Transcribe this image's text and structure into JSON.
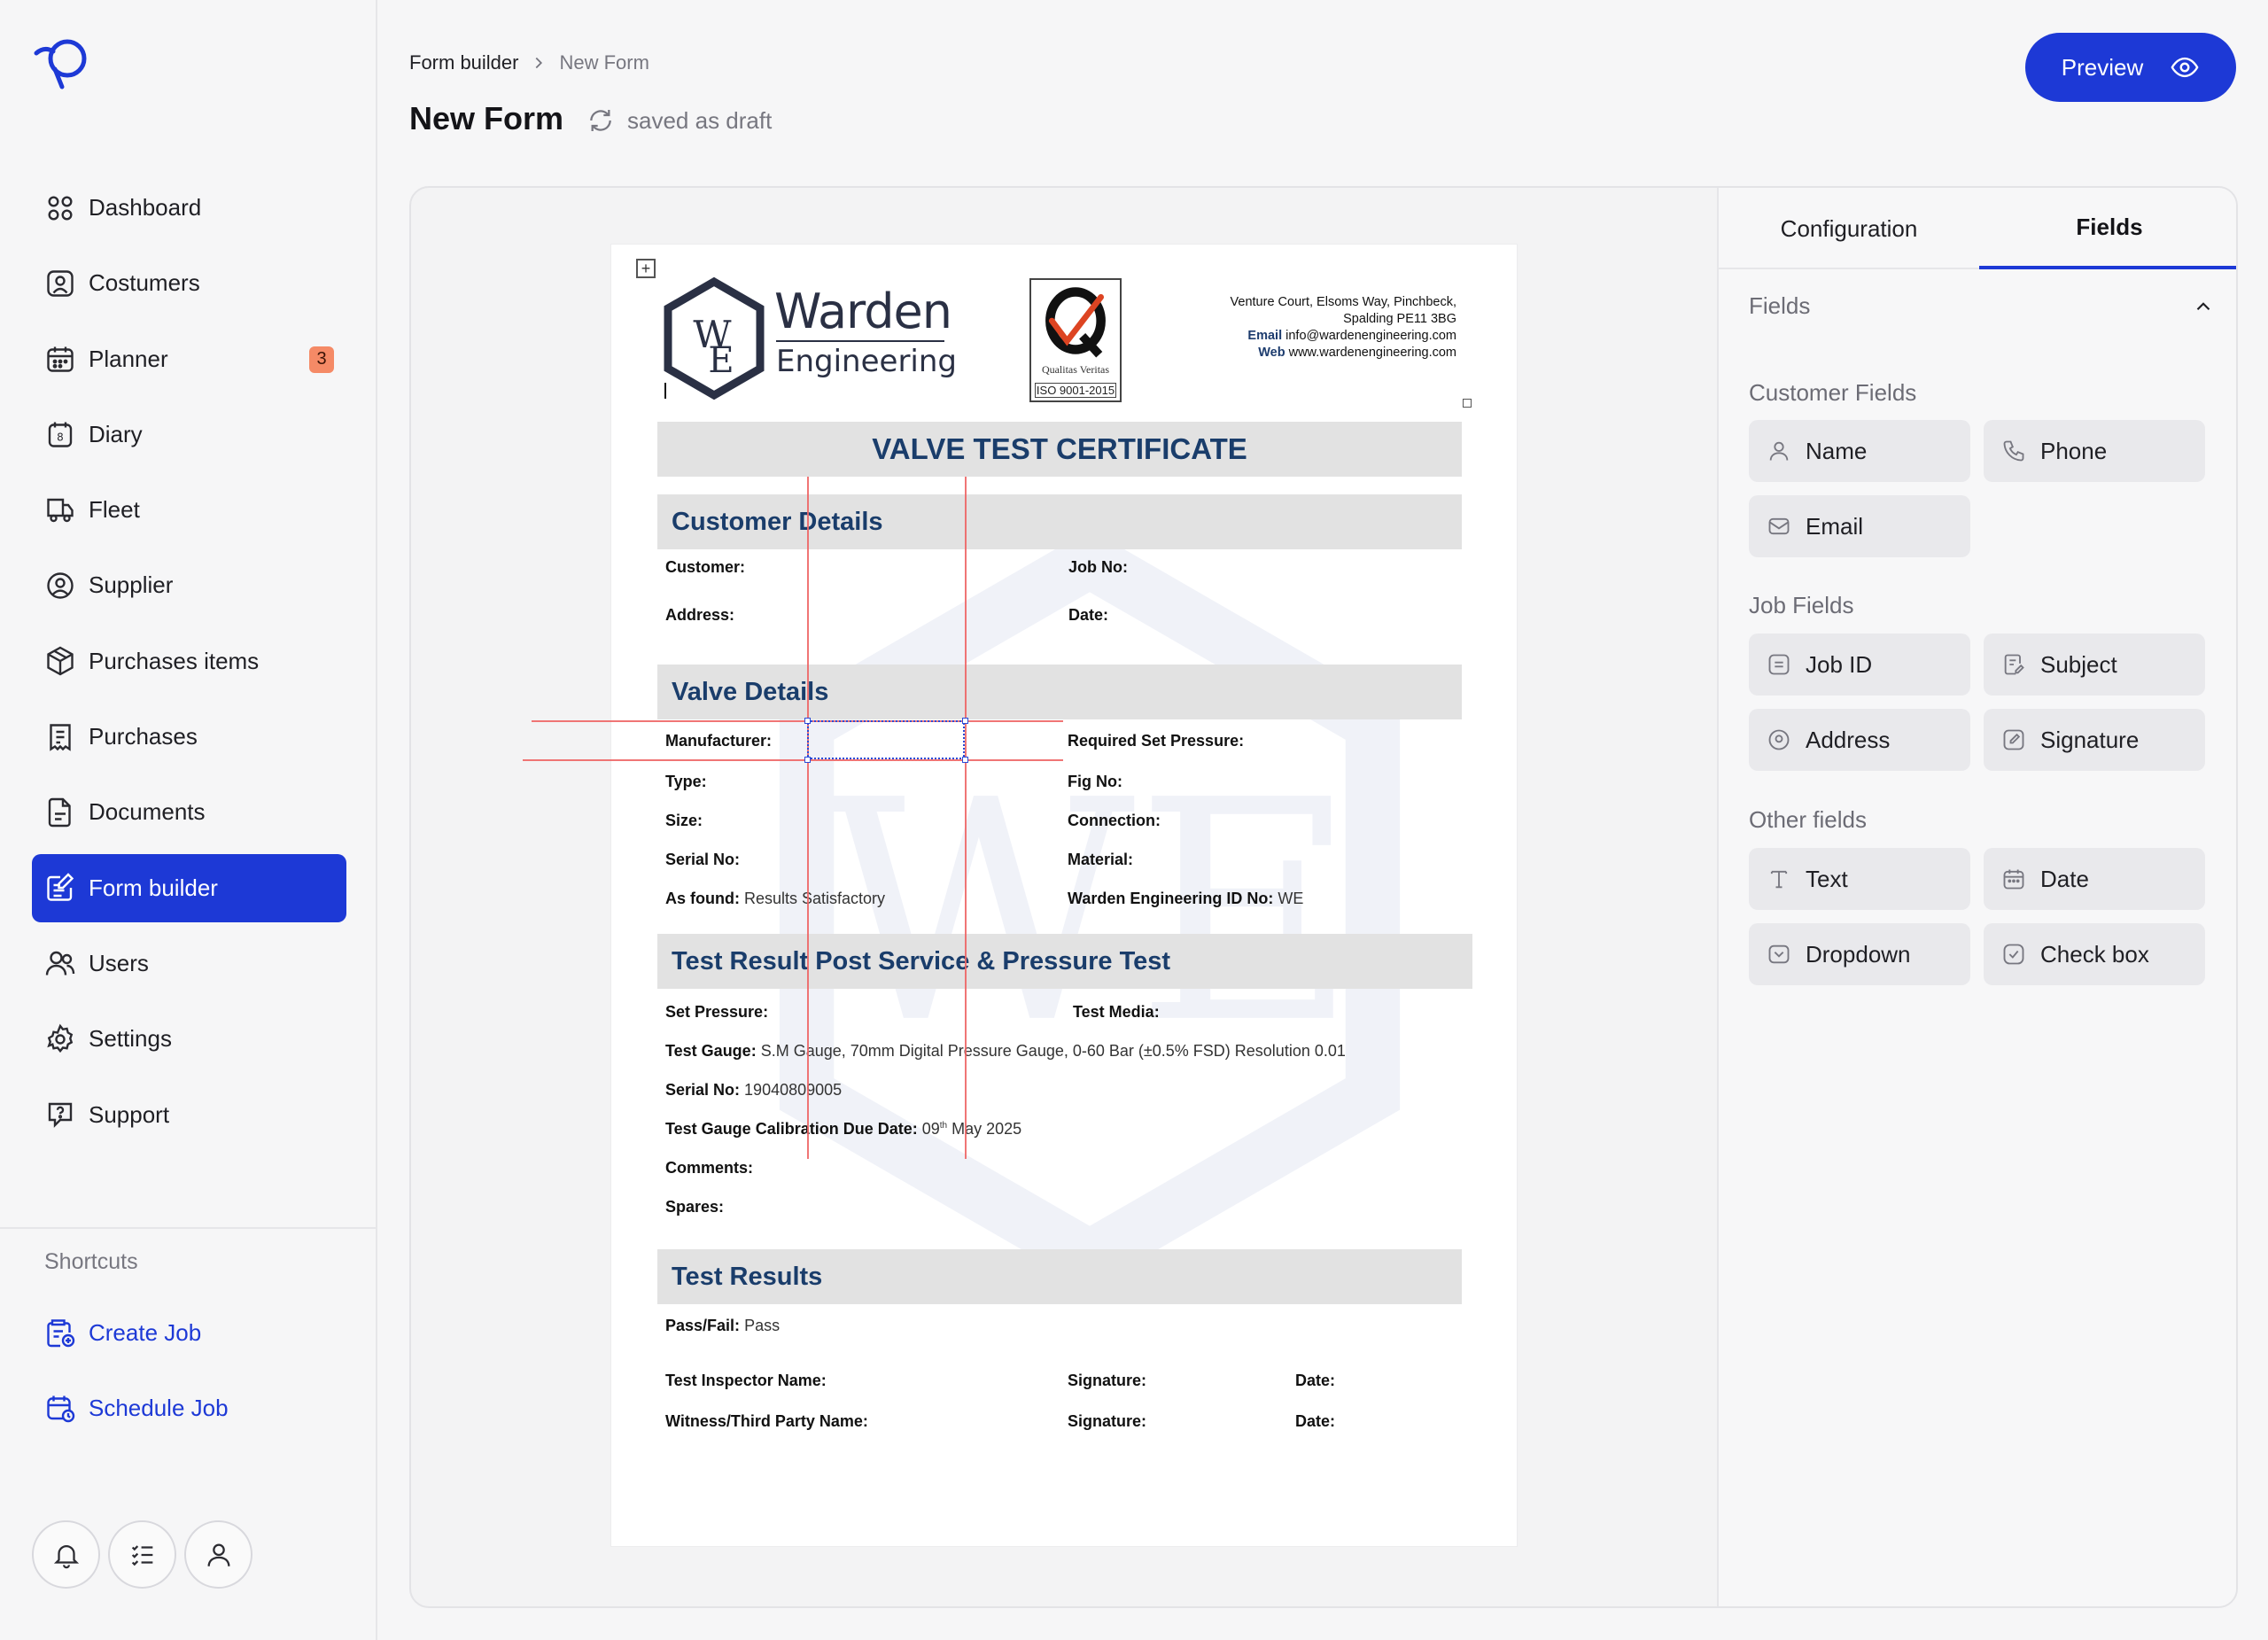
{
  "sidebar": {
    "items": [
      {
        "label": "Dashboard",
        "icon": "dashboard-icon"
      },
      {
        "label": "Costumers",
        "icon": "customers-icon"
      },
      {
        "label": "Planner",
        "icon": "calendar-icon",
        "badge": "3"
      },
      {
        "label": "Diary",
        "icon": "diary-icon"
      },
      {
        "label": "Fleet",
        "icon": "truck-icon"
      },
      {
        "label": "Supplier",
        "icon": "supplier-icon"
      },
      {
        "label": "Purchases items",
        "icon": "box-icon"
      },
      {
        "label": "Purchases",
        "icon": "receipt-icon"
      },
      {
        "label": "Documents",
        "icon": "document-icon"
      },
      {
        "label": "Form builder",
        "icon": "form-builder-icon",
        "active": true
      },
      {
        "label": "Users",
        "icon": "users-icon"
      },
      {
        "label": "Settings",
        "icon": "gear-icon"
      },
      {
        "label": "Support",
        "icon": "support-icon"
      }
    ],
    "shortcuts_title": "Shortcuts",
    "shortcuts": [
      {
        "label": "Create Job",
        "icon": "create-job-icon"
      },
      {
        "label": "Schedule Job",
        "icon": "schedule-job-icon"
      }
    ],
    "accent_color": "#1d39d6",
    "badge_color": "#f58a66"
  },
  "header": {
    "breadcrumb": [
      "Form builder",
      "New Form"
    ],
    "title": "New Form",
    "status": "saved as draft",
    "preview_label": "Preview"
  },
  "document": {
    "company_line1": "Warden",
    "company_line2": "Engineering",
    "iso_caption": "Qualitas Veritas",
    "iso_label": "ISO 9001-2015",
    "address_line1": "Venture Court, Elsoms Way, Pinchbeck,",
    "address_line2": "Spalding PE11 3BG",
    "email_label": "Email",
    "email_value": "info@wardenengineering.com",
    "web_label": "Web",
    "web_value": "www.wardenengineering.com",
    "title": "VALVE TEST CERTIFICATE",
    "sections": {
      "customer": "Customer Details",
      "valve": "Valve Details",
      "test": "Test Result Post Service & Pressure Test",
      "results": "Test Results"
    },
    "customer_fields": {
      "customer": "Customer:",
      "job_no": "Job No:",
      "address": "Address:",
      "date": "Date:"
    },
    "valve_fields": {
      "manufacturer": "Manufacturer:",
      "required_set_pressure": "Required Set Pressure:",
      "type": "Type:",
      "fig_no": "Fig No:",
      "size": "Size:",
      "connection": "Connection:",
      "serial_no": "Serial No:",
      "material": "Material:",
      "as_found": "As found:",
      "as_found_value": "Results Satisfactory",
      "warden_id": "Warden Engineering ID No:",
      "warden_id_value": "WE"
    },
    "test_fields": {
      "set_pressure": "Set Pressure:",
      "test_media": "Test Media:",
      "test_gauge": "Test Gauge:",
      "test_gauge_value": "S.M Gauge, 70mm Digital Pressure Gauge, 0-60 Bar (±0.5% FSD) Resolution 0.01",
      "serial_no": "Serial No:",
      "serial_no_value": "19040809005",
      "calibration": "Test Gauge Calibration Due Date:",
      "calibration_day": "09",
      "calibration_suffix": "th",
      "calibration_rest": "May 2025",
      "comments": "Comments:",
      "spares": "Spares:"
    },
    "results_fields": {
      "pass_fail": "Pass/Fail:",
      "pass_fail_value": "Pass",
      "inspector": "Test Inspector Name:",
      "signature": "Signature:",
      "date": "Date:",
      "witness": "Witness/Third Party Name:"
    }
  },
  "panel": {
    "tabs": [
      {
        "label": "Configuration",
        "active": false
      },
      {
        "label": "Fields",
        "active": true
      }
    ],
    "fields_title": "Fields",
    "groups": [
      {
        "title": "Customer Fields",
        "items": [
          {
            "label": "Name",
            "icon": "user-icon"
          },
          {
            "label": "Phone",
            "icon": "phone-icon"
          },
          {
            "label": "Email",
            "icon": "mail-icon"
          }
        ]
      },
      {
        "title": "Job Fields",
        "items": [
          {
            "label": "Job ID",
            "icon": "id-icon"
          },
          {
            "label": "Subject",
            "icon": "subject-icon"
          },
          {
            "label": "Address",
            "icon": "location-icon"
          },
          {
            "label": "Signature",
            "icon": "signature-icon"
          }
        ]
      },
      {
        "title": "Other fields",
        "items": [
          {
            "label": "Text",
            "icon": "text-icon"
          },
          {
            "label": "Date",
            "icon": "date-icon"
          },
          {
            "label": "Dropdown",
            "icon": "dropdown-icon"
          },
          {
            "label": "Check box",
            "icon": "checkbox-icon"
          }
        ]
      }
    ]
  }
}
